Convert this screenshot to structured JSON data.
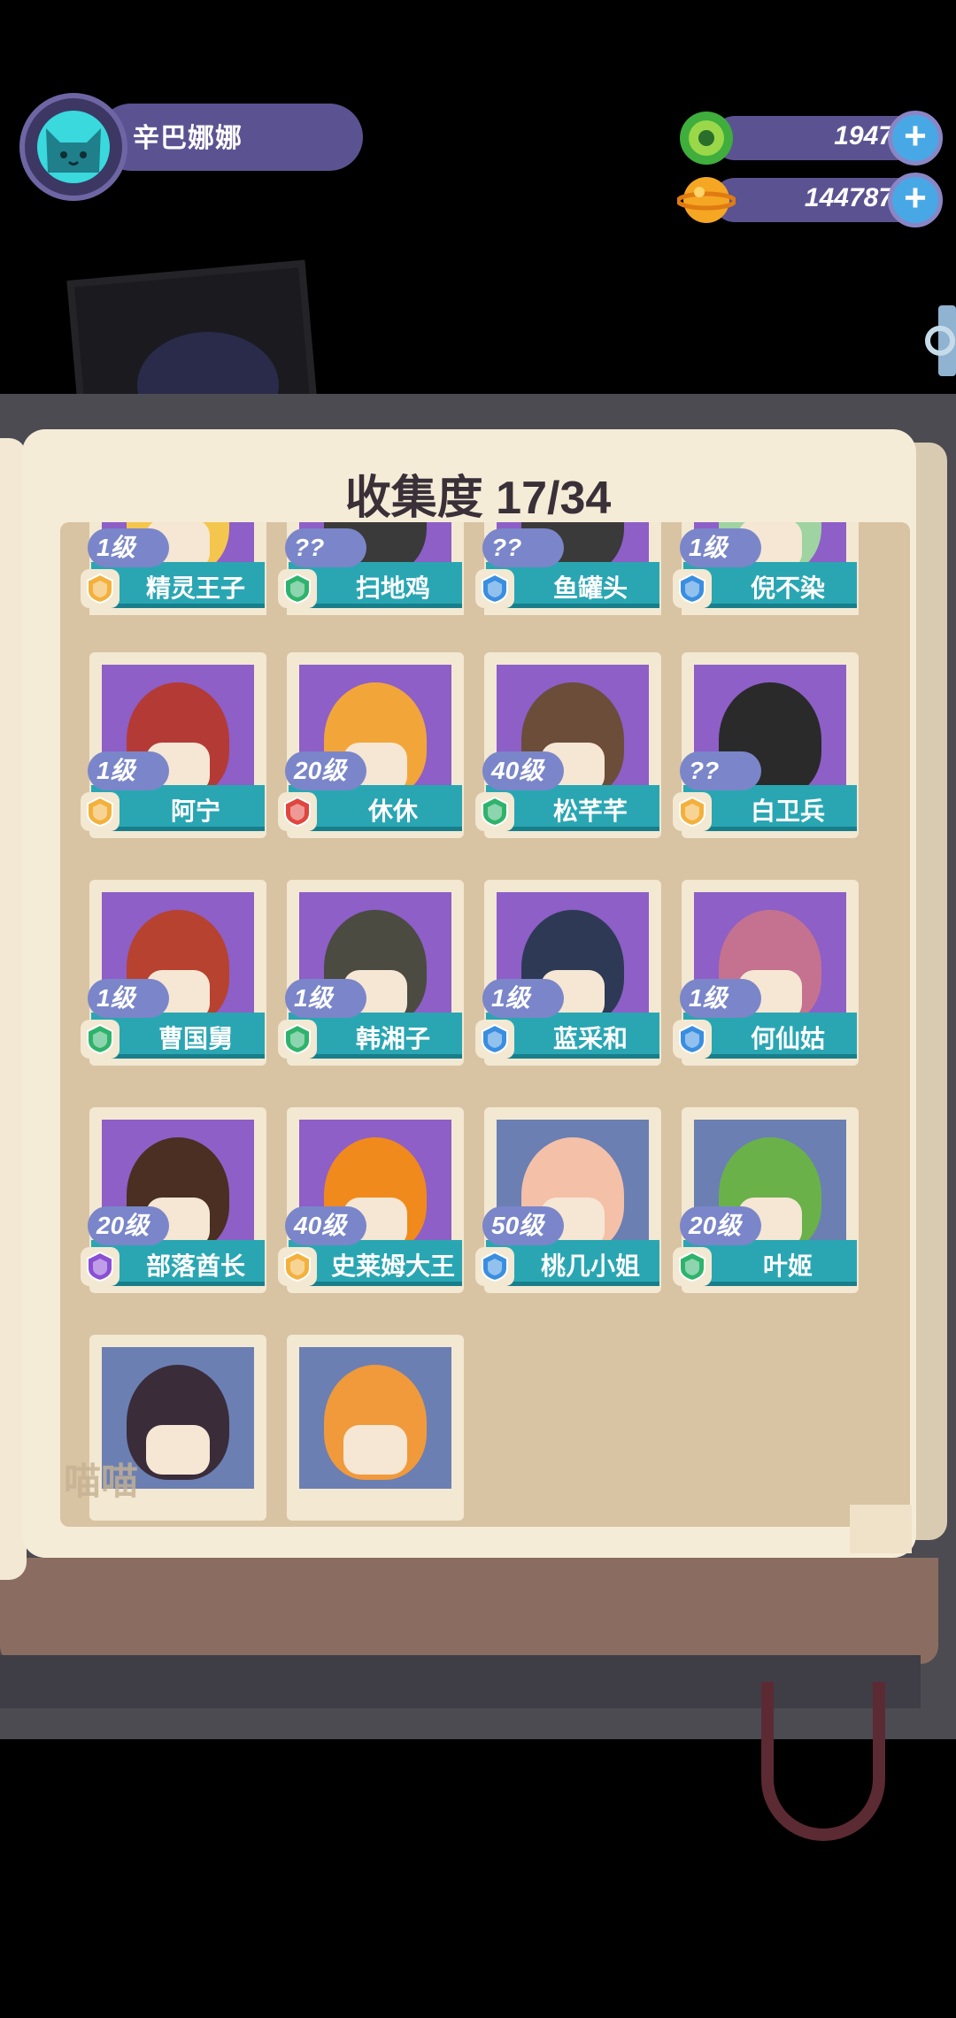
{
  "profile": {
    "name": "辛巴娜娜"
  },
  "currency": [
    {
      "icon": "green-gem-icon",
      "value": "1947"
    },
    {
      "icon": "orange-planet-coin-icon",
      "value": "144787"
    }
  ],
  "collection": {
    "title": "收集度 17/34"
  },
  "rows": [
    [
      {
        "level": "1级",
        "name": "精灵王子",
        "rarity_color": "#f3b13c",
        "portrait": "#f5c64e"
      },
      {
        "level": "??",
        "name": "扫地鸡",
        "rarity_color": "#2fb36c",
        "portrait": "#3a3a3a"
      },
      {
        "level": "??",
        "name": "鱼罐头",
        "rarity_color": "#3a8ee0",
        "portrait": "#3a3a3a"
      },
      {
        "level": "1级",
        "name": "倪不染",
        "rarity_color": "#3a8ee0",
        "portrait": "#9fd3a2"
      }
    ],
    [
      {
        "level": "1级",
        "name": "阿宁",
        "rarity_color": "#f3b13c",
        "portrait": "#b43a36"
      },
      {
        "level": "20级",
        "name": "休休",
        "rarity_color": "#e0463e",
        "portrait": "#f2a63a"
      },
      {
        "level": "40级",
        "name": "松芊芊",
        "rarity_color": "#2fb36c",
        "portrait": "#6b4d3a"
      },
      {
        "level": "??",
        "name": "白卫兵",
        "rarity_color": "#f3b13c",
        "portrait": "#2a2a2a"
      }
    ],
    [
      {
        "level": "1级",
        "name": "曹国舅",
        "rarity_color": "#2fb36c",
        "portrait": "#b7422f"
      },
      {
        "level": "1级",
        "name": "韩湘子",
        "rarity_color": "#2fb36c",
        "portrait": "#4b4b42"
      },
      {
        "level": "1级",
        "name": "蓝采和",
        "rarity_color": "#3a8ee0",
        "portrait": "#2e3a55"
      },
      {
        "level": "1级",
        "name": "何仙姑",
        "rarity_color": "#3a8ee0",
        "portrait": "#c4728f"
      }
    ],
    [
      {
        "level": "20级",
        "name": "部落酋长",
        "rarity_color": "#8a4fd4",
        "portrait": "#4a2f22"
      },
      {
        "level": "40级",
        "name": "史莱姆大王",
        "rarity_color": "#f3b13c",
        "portrait": "#f08a1c"
      },
      {
        "level": "50级",
        "name": "桃几小姐",
        "rarity_color": "#3a8ee0",
        "portrait": "#f4c0a8"
      },
      {
        "level": "20级",
        "name": "叶姬",
        "rarity_color": "#2fb36c",
        "portrait": "#6bb14a"
      }
    ],
    [
      {
        "level": "",
        "name": "",
        "rarity_color": "#3a8ee0",
        "portrait": "#3b2c3a"
      },
      {
        "level": "",
        "name": "",
        "rarity_color": "#f3b13c",
        "portrait": "#f09a3c"
      }
    ]
  ],
  "watermark": "喵喵"
}
